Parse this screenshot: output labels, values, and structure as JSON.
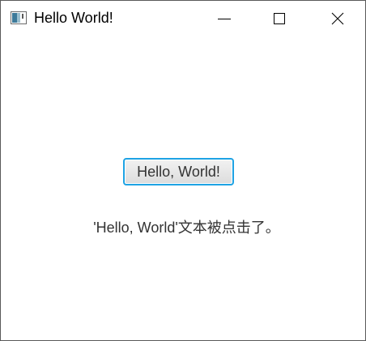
{
  "window": {
    "title": "Hello World!",
    "controls": {
      "minimize": "minimize-icon",
      "maximize": "maximize-icon",
      "close": "close-icon"
    }
  },
  "main": {
    "button_label": "Hello, World!",
    "message": "'Hello, World'文本被点击了。"
  },
  "colors": {
    "button_focus_border": "#1fa3e4",
    "text": "#333333",
    "background": "#ffffff"
  }
}
